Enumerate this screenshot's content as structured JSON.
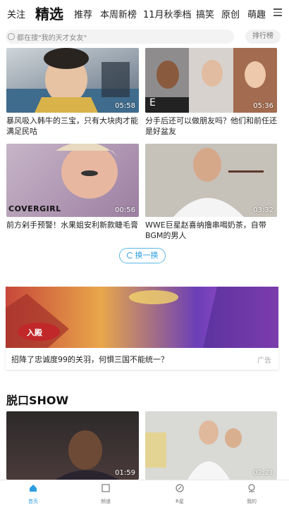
{
  "tabs": [
    "关注",
    "精选",
    "推荐",
    "本周新榜",
    "11月秋季档",
    "搞笑",
    "原创",
    "萌趣"
  ],
  "search": {
    "placeholder": "都在搜\"我的天才女友\"",
    "rank_label": "排行榜"
  },
  "videos": [
    {
      "caption": "暴风吸入韩牛的三宝，只有大块肉才能满足民咕",
      "duration": "05:58"
    },
    {
      "caption": "分手后还可以做朋友吗？他们和前任还是好盆友",
      "duration": "05:36"
    },
    {
      "caption": "前方剁手预警！水果姐安利新款睫毛膏",
      "duration": "00:56",
      "overlay_text": "COVERGIRL"
    },
    {
      "caption": "WWE巨星赵喜纳撸串喝奶茶，自带BGM的男人",
      "duration": "03:32"
    }
  ],
  "refresh_label": "换一换",
  "ad": {
    "text": "招降了忠诚度99的关羽，何惧三国不能统一？",
    "tag": "广告",
    "button": "入殿"
  },
  "section_title": "脱口SHOW",
  "section_videos": [
    {
      "duration": "01:59"
    },
    {
      "duration": "02:21"
    }
  ],
  "bottom_nav": [
    "首页",
    "频道",
    "R星",
    "我的"
  ],
  "colors": {
    "accent": "#2c9ee0"
  }
}
